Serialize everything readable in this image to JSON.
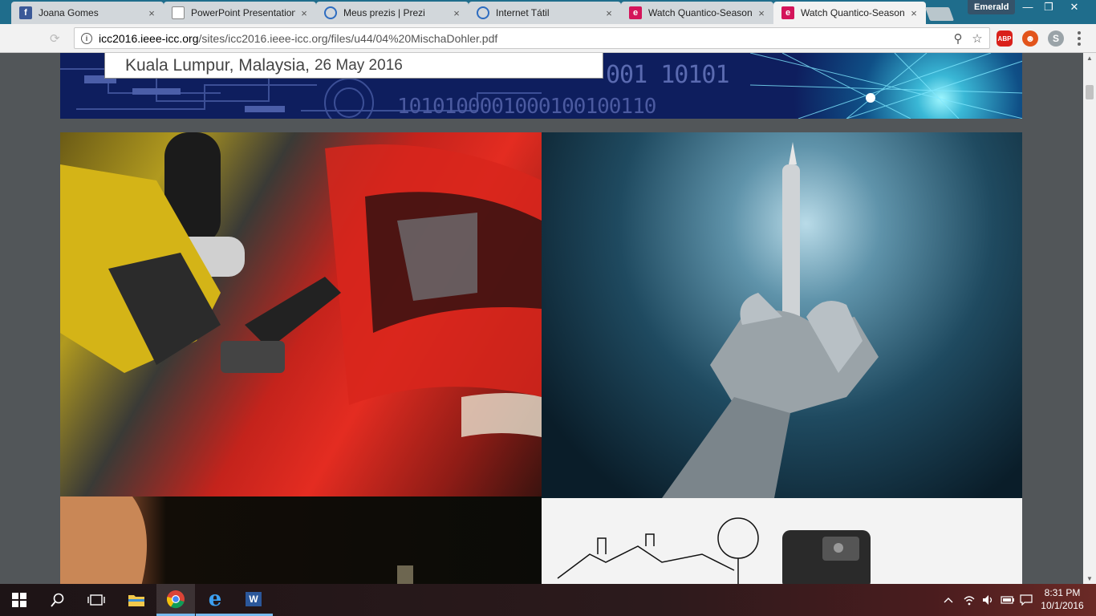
{
  "tabs": [
    {
      "title": "Joana Gomes",
      "icon": "facebook-icon",
      "icon_glyph": "f",
      "icon_color": "#3b5998",
      "active": false
    },
    {
      "title": "PowerPoint Presentation",
      "icon": "document-icon",
      "icon_glyph": "",
      "icon_color": "#ffffff",
      "active": false
    },
    {
      "title": "Meus prezis | Prezi",
      "icon": "prezi-icon",
      "icon_glyph": "",
      "icon_color": "#2d6cc0",
      "active": false
    },
    {
      "title": "Internet Tátil",
      "icon": "prezi-icon",
      "icon_glyph": "",
      "icon_color": "#2d6cc0",
      "active": false
    },
    {
      "title": "Watch Quantico-Season",
      "icon": "e-site-icon",
      "icon_glyph": "e",
      "icon_color": "#d4145a",
      "active": false
    },
    {
      "title": "Watch Quantico-Season",
      "icon": "e-site-icon",
      "icon_glyph": "e",
      "icon_color": "#d4145a",
      "active": true
    }
  ],
  "tab_close_glyph": "×",
  "profile_name": "Emerald",
  "window_controls": {
    "minimize": "—",
    "restore": "❐",
    "close": "✕"
  },
  "address": {
    "host": "icc2016.ieee-icc.org",
    "path": "/sites/icc2016.ieee-icc.org/files/u44/04%20MischaDohler.pdf",
    "info_glyph": "i",
    "zoom_glyph": "⚲",
    "star_glyph": "☆"
  },
  "extensions": [
    {
      "name": "adblock-plus-icon",
      "label": "ABP",
      "color": "#d9201a"
    },
    {
      "name": "extension-face-icon",
      "label": "☻",
      "color": "#e2541b"
    },
    {
      "name": "skype-icon",
      "label": "S",
      "color": "#9aa3a8"
    }
  ],
  "pdf": {
    "banner_location": "Kuala Lumpur, Malaysia,",
    "banner_date": "26 May 2016",
    "banner_binary_1": "001 10101",
    "banner_binary_2": "1010100001000100100110"
  },
  "taskbar": {
    "apps": [
      {
        "name": "start-button",
        "glyph": "⊞"
      },
      {
        "name": "search-button",
        "glyph": "⚲"
      },
      {
        "name": "task-view-button",
        "glyph": "❐"
      },
      {
        "name": "file-explorer-icon",
        "glyph": "📁"
      },
      {
        "name": "chrome-icon",
        "glyph": ""
      },
      {
        "name": "edge-icon",
        "glyph": "e"
      },
      {
        "name": "word-icon",
        "glyph": "W"
      }
    ],
    "tray": {
      "chevron": "^",
      "wifi": "≋",
      "volume": "🔊",
      "battery": "▭",
      "notifications": "▤"
    },
    "time": "8:31 PM",
    "date": "10/1/2016"
  },
  "colors": {
    "tabstrip": "#1f6d8c",
    "viewer_bg": "#525659",
    "taskbar_accent": "#76b9ed"
  }
}
